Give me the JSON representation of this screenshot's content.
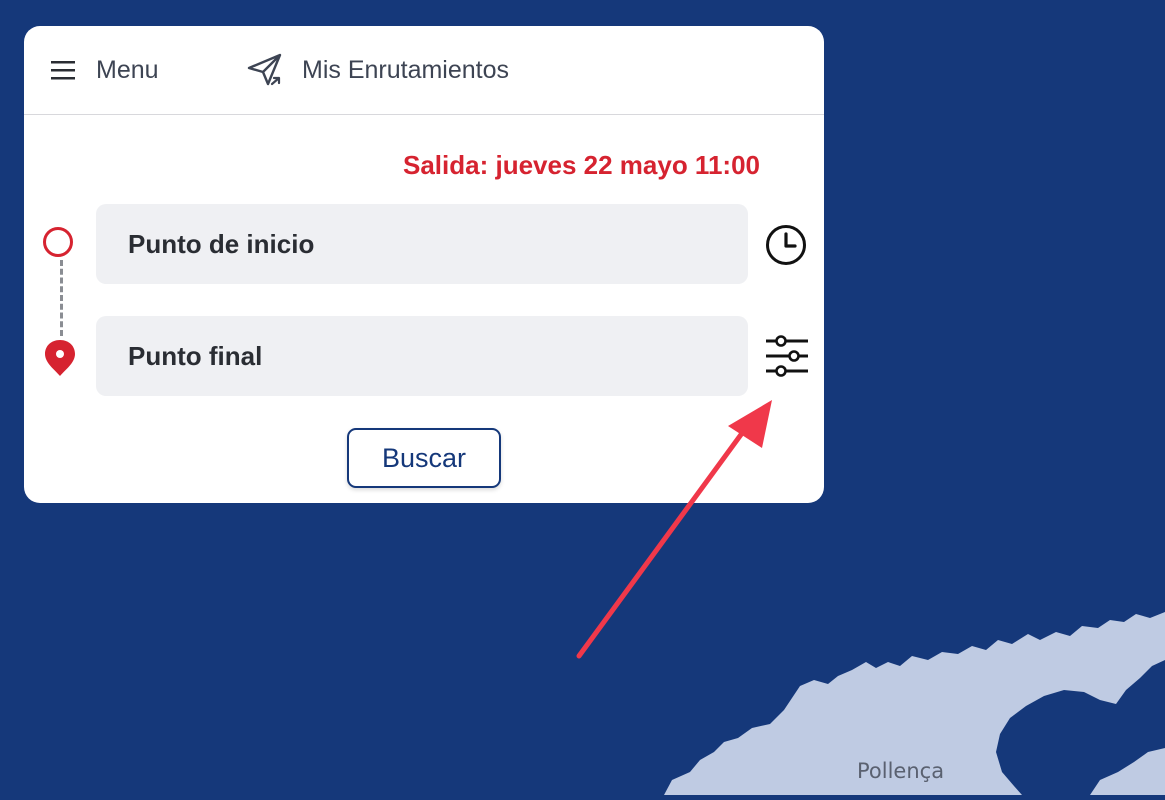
{
  "header": {
    "menu_label": "Menu",
    "routes_label": "Mis Enrutamientos"
  },
  "planner": {
    "departure_text": "Salida: jueves 22 mayo 11:00",
    "start_placeholder": "Punto de inicio",
    "end_placeholder": "Punto final",
    "search_label": "Buscar"
  },
  "map": {
    "place_label": "Pollença"
  },
  "icons": {
    "menu": "hamburger-icon",
    "routes": "send-route-icon",
    "clock": "clock-icon",
    "filters": "sliders-icon",
    "start": "start-circle-icon",
    "end": "location-pin-icon"
  },
  "colors": {
    "background": "#15387a",
    "accent_red": "#d62330",
    "land": "#bfcbe3",
    "field_bg": "#eff0f3"
  }
}
